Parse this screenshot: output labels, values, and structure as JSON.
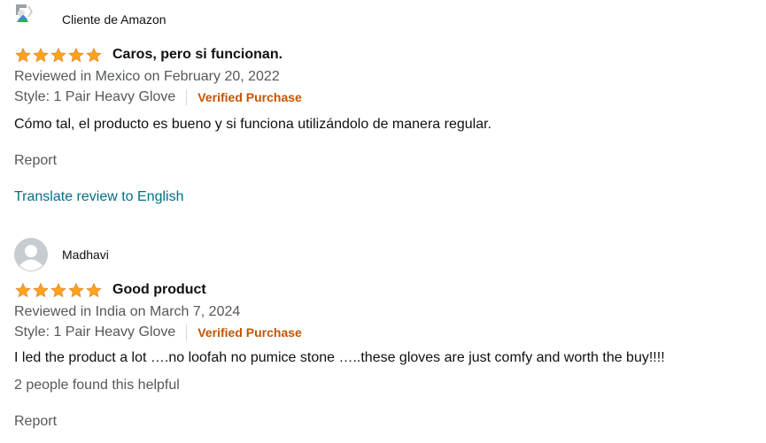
{
  "reviews": [
    {
      "reviewer": "Cliente de Amazon",
      "avatar": "broken-image-icon",
      "rating": 5,
      "title": "Caros, pero si funcionan.",
      "reviewed": "Reviewed in Mexico on February 20, 2022",
      "style": "Style: 1 Pair Heavy Glove",
      "verified": "Verified Purchase",
      "body": "Cómo tal, el producto es bueno y si funciona utilizándolo de manera regular.",
      "report": "Report",
      "translate": "Translate review to English"
    },
    {
      "reviewer": "Madhavi",
      "avatar": "default-avatar-icon",
      "rating": 5,
      "title": "Good product",
      "reviewed": "Reviewed in India on March 7, 2024",
      "style": "Style: 1 Pair Heavy Glove",
      "verified": "Verified Purchase",
      "body": "I led the product a lot ….no loofah no pumice stone …..these gloves are just comfy and worth the buy!!!!",
      "helpful": "2 people found this helpful",
      "report": "Report"
    }
  ],
  "colors": {
    "star": "#ffa41c",
    "star_stroke": "#de7921",
    "verified": "#c45500",
    "link": "#007185",
    "secondary_text": "#565959"
  }
}
